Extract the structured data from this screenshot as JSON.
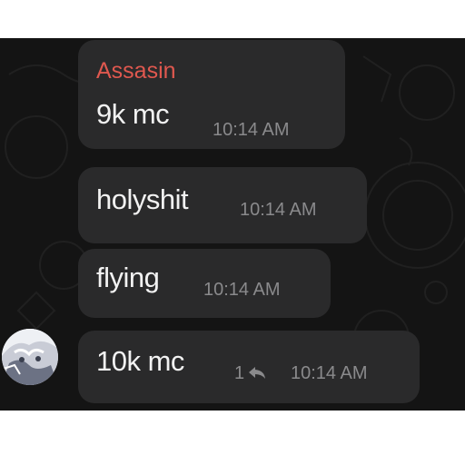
{
  "chat": {
    "sender": {
      "name": "Assasin",
      "color": "#e0584f"
    },
    "messages": [
      {
        "text": "9k mc",
        "time": "10:14 AM"
      },
      {
        "text": "holyshit",
        "time": "10:14 AM"
      },
      {
        "text": "flying",
        "time": "10:14 AM"
      },
      {
        "text": "10k mc",
        "time": "10:14 AM",
        "reply_count": "1",
        "reply_icon": "reply-arrow-icon"
      }
    ],
    "avatar": {
      "icon": "avatar-image"
    }
  },
  "colors": {
    "background": "#141414",
    "bubble": "#2a2a2b",
    "text": "#f2f2f2",
    "meta": "#8a8a8c"
  }
}
